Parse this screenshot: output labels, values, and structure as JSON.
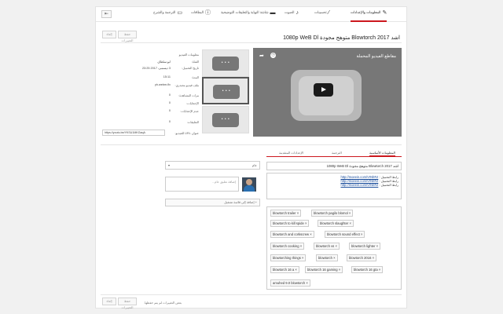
{
  "tabs": [
    {
      "label": "المعلومات والإعدادات",
      "icon": "pencil-icon",
      "active": true
    },
    {
      "label": "تحسينات",
      "icon": "wand-icon",
      "active": false
    },
    {
      "label": "الصوت",
      "icon": "music-note-icon",
      "active": false
    },
    {
      "label": "شاشة النهاية والتعليقات التوضيحية",
      "icon": "film-icon",
      "active": false
    },
    {
      "label": "البطاقات",
      "icon": "info-icon",
      "active": false
    },
    {
      "label": "الترجمة والشرح",
      "icon": "subtitles-icon",
      "active": false
    }
  ],
  "back_glyph": "⇤",
  "video_title": "اشد 2017 Blowtorch متوهج مجودة 1080p WeB Dl",
  "buttons": {
    "cancel": "إلغاء",
    "save": "حفظ التغييرات"
  },
  "player": {
    "title": "مقاطع الفيديو المحملة"
  },
  "info": [
    {
      "label": "معلومات الفيديو",
      "value": ""
    },
    {
      "label": "القناة:",
      "value": "ابو سلطان"
    },
    {
      "label": "تاريخ التحميل:",
      "value": "3 ديسمبر، 2017 23:25"
    },
    {
      "label": "المدة:",
      "value": "15:11"
    },
    {
      "label": "ملف فيديو مصدري:",
      "value": "yh.webm.flv"
    },
    {
      "label": "مرات المشاهدة:",
      "value": "0"
    },
    {
      "label": "الإعجابات:",
      "value": "0"
    },
    {
      "label": "عدم الإعجابات:",
      "value": "0"
    },
    {
      "label": "التعليقات:",
      "value": "0"
    },
    {
      "label": "عنوان URL للفيديو:",
      "value": "https://youtu.be/YKSU1MKGaqA"
    }
  ],
  "subtabs": [
    {
      "label": "المعلومات الأساسية",
      "active": true
    },
    {
      "label": "الترجمة",
      "active": false
    },
    {
      "label": "الإعدادات المتقدمة",
      "active": false
    }
  ],
  "form": {
    "title_value": "اشد 2017 Blowtorch متوهج مجودة 1080p WeB Dl",
    "description_lines": [
      {
        "label": "رابط التحميل :",
        "link": "http://moeein.com/VrNhRJ"
      },
      {
        "label": "رابط التحميل :",
        "link": "http://moeein.com/VrNhRJ"
      },
      {
        "label": "رابط التحميل :",
        "link": "http://moeein.com/VrNhRJ"
      }
    ],
    "visibility": "عام",
    "comment_placeholder": "إضافة تعليق عام...",
    "add_comment": "+ إضافة إلى قائمة تشغيل"
  },
  "tags": [
    "blowtorch trailer",
    "blowtorch pagilo blomol",
    "blowtorch to kill spide",
    "blowtorch slaughter",
    "blowtorch and corkscrew",
    "blowtorch sound effect",
    "blowtorch cooking",
    "blowtorch vs",
    "blowtorch lighter",
    "blowtorching things",
    "blowtorch",
    "blowtorch 2016",
    "blowtorch 16 a",
    "blowtorch 16 gaming",
    "blowtorch 16 gta",
    "amuhed 9.0 blowtorch"
  ],
  "footer_note": "بعض التغييرات لم يتم حفظها."
}
